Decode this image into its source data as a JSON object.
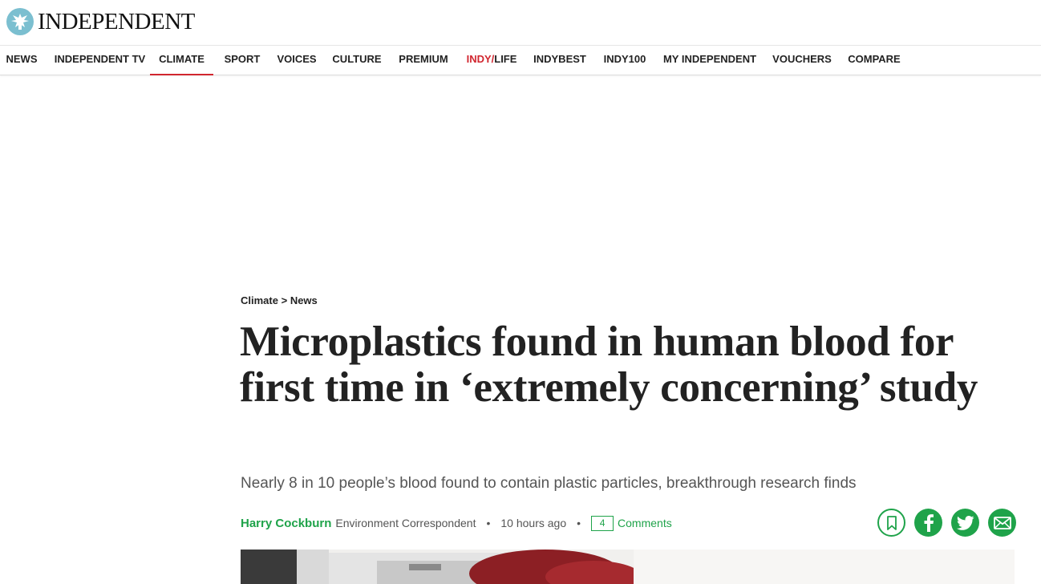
{
  "site": {
    "name": "INDEPENDENT"
  },
  "nav": {
    "items": [
      {
        "label": "NEWS"
      },
      {
        "label": "INDEPENDENT TV"
      },
      {
        "label": "CLIMATE"
      },
      {
        "label": "SPORT"
      },
      {
        "label": "VOICES"
      },
      {
        "label": "CULTURE"
      },
      {
        "label": "PREMIUM"
      },
      {
        "label_a": "INDY/",
        "label_b": "LIFE"
      },
      {
        "label": "INDYBEST"
      },
      {
        "label": "INDY100"
      },
      {
        "label": "MY INDEPENDENT"
      },
      {
        "label": "VOUCHERS"
      },
      {
        "label": "COMPARE"
      }
    ],
    "active": "CLIMATE"
  },
  "breadcrumb": {
    "section": "Climate",
    "separator": ">",
    "subsection": "News"
  },
  "article": {
    "headline": "Microplastics found in human blood for first time in ‘extremely concerning’ study",
    "standfirst": "Nearly 8 in 10 people’s blood found to contain plastic particles, breakthrough research finds",
    "author": "Harry Cockburn",
    "author_role": "Environment Correspondent",
    "bullet": "•",
    "time": "10 hours ago",
    "comment_count": "4",
    "comments_label": "Comments"
  },
  "share": {
    "icons": [
      "bookmark-icon",
      "facebook-icon",
      "twitter-icon",
      "email-icon"
    ]
  },
  "colors": {
    "accent_green": "#1fa34a",
    "accent_red": "#d1262f",
    "logo_blue": "#7bbfd0"
  }
}
